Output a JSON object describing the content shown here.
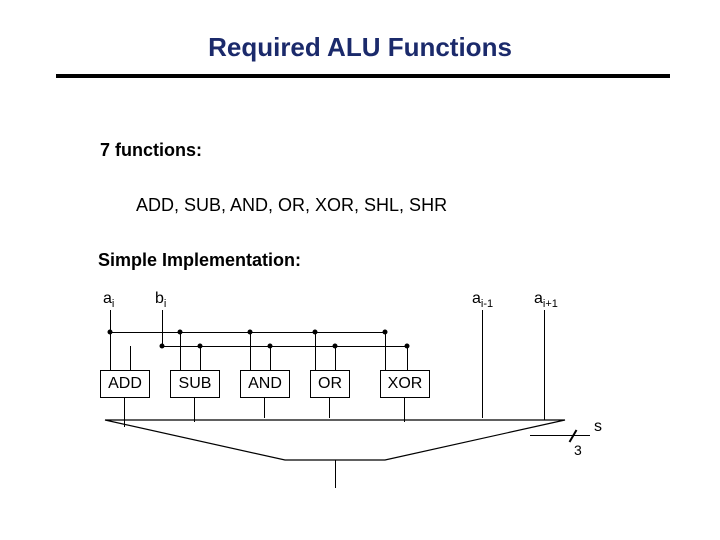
{
  "title": "Required ALU Functions",
  "heading_count": "7 functions:",
  "functions_list": "ADD, SUB, AND, OR, XOR, SHL, SHR",
  "heading_impl": "Simple Implementation:",
  "wire_labels": {
    "ai_base": "a",
    "ai_sub": "i",
    "bi_base": "b",
    "bi_sub": "i",
    "aim1_base": "a",
    "aim1_sub": "i-1",
    "aip1_base": "a",
    "aip1_sub": "i+1"
  },
  "op_boxes": {
    "add": "ADD",
    "sub": "SUB",
    "and": "AND",
    "or": "OR",
    "xor": "XOR"
  },
  "select": {
    "name": "s",
    "width": "3"
  }
}
